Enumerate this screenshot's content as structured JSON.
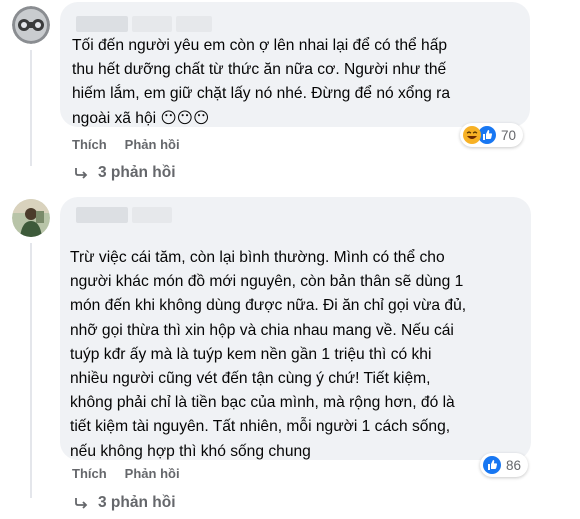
{
  "comments": [
    {
      "text": "Tối đến người yêu em còn ợ lên nhai lại để có thể hấp\nthu hết dưỡng chất từ thức ăn nữa cơ. Người như thế\nhiếm lắm, em giữ chặt lấy nó nhé. Đừng để nó xổng ra\nngoài xã hội 😶😶😶",
      "reaction_count": "70",
      "reactions": [
        "haha-icon",
        "like-icon"
      ],
      "like_label": "Thích",
      "reply_label": "Phản hồi",
      "replies_label": "3 phản hồi"
    },
    {
      "text": "Trừ việc cái tăm, còn lại bình thường. Mình có thể cho\nngười khác món đồ mới nguyên, còn bản thân sẽ dùng 1\nmón đến khi không dùng được nữa. Đi ăn chỉ gọi vừa đủ,\nnhỡ gọi thừa thì xin hộp và chia nhau mang về. Nếu cái\ntuýp kđr ấy mà là tuýp kem nền gần 1 triệu thì có khi\nnhiều người cũng vét đến tận cùng ý chứ! Tiết kiệm,\nkhông phải chỉ là tiền bạc của mình, mà rộng hơn, đó là\ntiết kiệm tài nguyên. Tất nhiên, mỗi người 1 cách sống,\nnếu không hợp thì khó sống chung",
      "reaction_count": "86",
      "reactions": [
        "like-icon"
      ],
      "like_label": "Thích",
      "reply_label": "Phản hồi",
      "replies_label": "3 phản hồi"
    }
  ],
  "colors": {
    "bubble": "#f0f2f5",
    "meta_text": "#65676b",
    "like_blue": "#1877f2",
    "haha_yellow": "#f7b125"
  }
}
